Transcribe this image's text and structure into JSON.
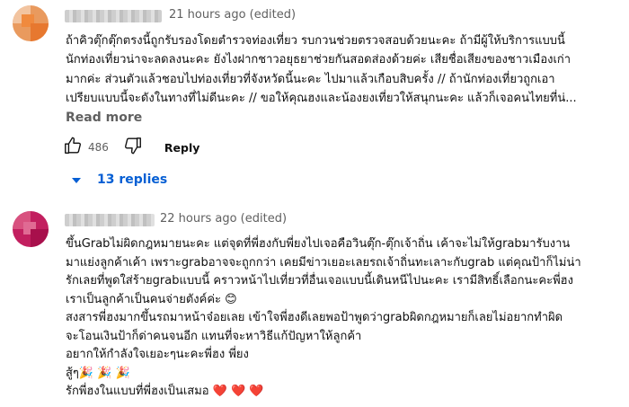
{
  "comments": [
    {
      "timestamp": "21 hours ago (edited)",
      "lines": [
        "ถ้าคิวตุ๊กตุ๊กตรงนี้ถูกรับรองโดยตำรวจท่องเที่ยว รบกวนช่วยตรวจสอบด้วยนะคะ ถ้ามีผู้ให้บริการแบบนี้",
        "นักท่องเที่ยวน่าจะลดลงนะคะ ยังไงฝากชาวอยุธยาช่วยกันสอดส่องด้วยค่ะ เสียชื่อเสียงของชาวเมืองเก่า",
        "มากค่ะ ส่วนตัวแล้วชอบไปท่องเที่ยวที่จังหวัดนี้นะคะ ไปมาแล้วเกือบสิบครั้ง // ถ้านักท่องเที่ยวถูกเอา",
        "เปรียบแบบนี้จะดังในทางที่ไม่ดีนะคะ // ขอให้คุณฮงและน้องยงเที่ยวให้สนุกนะคะ แล้วก็เจอคนไทยที่น่..."
      ],
      "read_more": "Read more",
      "likes": "486",
      "reply_label": "Reply",
      "replies_label": "13 replies"
    },
    {
      "timestamp": "22 hours ago (edited)",
      "lines": [
        "ขึ้นGrabไม่ผิดกฎหมายนะคะ แต่จุดที่พี่ฮงกับพี่ยงไปเจอคือวินตุ๊ก-ตุ๊กเจ้าถิ่น เค้าจะไม่ให้grabมารับงาน",
        "มาแย่งลูกค้าเค้า เพราะgrabอาจจะถูกกว่า เคยมีข่าวเยอะเลยรถเจ้าถิ่นทะเลาะกับgrab แต่คุณป้าก็ไม่น่า",
        "รักเลยที่พูดใส่ร้ายgrabแบบนี้ คราวหน้าไปเที่ยวที่อื่นเจอแบบนี้เดินหนีไปนะคะ เรามีสิทธิ์เลือกนะคะพี่ฮง",
        "เราเป็นลูกค้าเป็นคนจ่ายตังค์ค่ะ 😊",
        "สงสารพี่ฮงมากขึ้นรถมาหน้าจ๋อยเลย เข้าใจพี่ฮงดีเลยพอป้าพูดว่าgrabผิดกฎหมายก็เลยไม่อยากทำผิด",
        "จะโอนเงินป้าก็ด่าคนจนอีก แทนที่จะหาวิธีแก้ปัญหาให้ลูกค้า",
        "อยากให้กำลังใจเยอะๆนะคะพี่ฮง พี่ยง",
        " สู้ๆ🎉 🎉 🎉",
        "รักพี่ฮงในแบบที่พี่ฮงเป็นเสมอ ❤️ ❤️ ❤️"
      ]
    }
  ],
  "icons": {
    "like": "thumb-up-icon",
    "dislike": "thumb-down-icon",
    "caret": "caret-down-icon"
  },
  "colors": {
    "link_blue": "#065fd4",
    "meta_gray": "#606060"
  }
}
